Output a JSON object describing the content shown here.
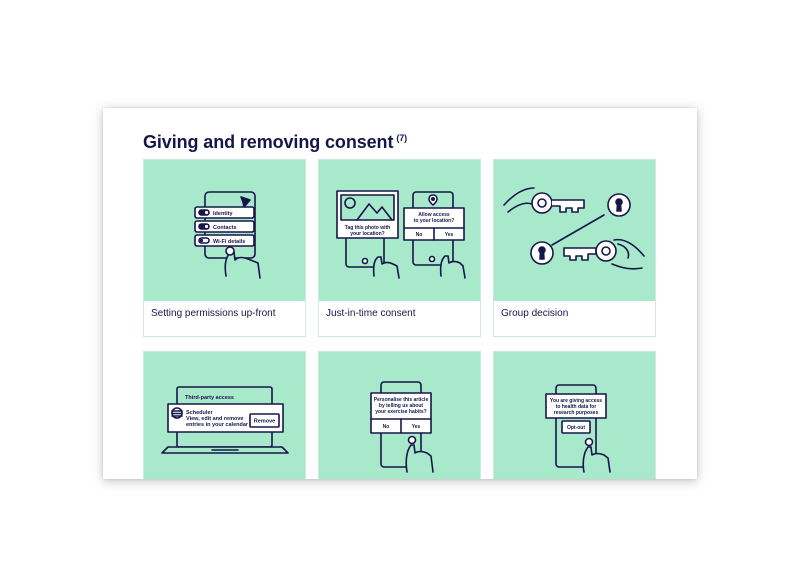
{
  "section": {
    "title": "Giving and removing consent",
    "count": "(7)"
  },
  "cards": [
    {
      "label": "Setting permissions up-front",
      "art": {
        "items": [
          "Identity",
          "Contacts",
          "Wi-Fi details"
        ]
      }
    },
    {
      "label": "Just-in-time consent",
      "art": {
        "photo_prompt": [
          "Tag this photo with",
          "your location?"
        ],
        "location_prompt": [
          "Allow access",
          "to your location?"
        ],
        "no": "No",
        "yes": "Yes"
      }
    },
    {
      "label": "Group decision",
      "art": {}
    },
    {
      "label": "",
      "art": {
        "header": "Third-party access",
        "app_name": "Scheduler",
        "app_desc": [
          "View, edit and remove",
          "entries in your calendar"
        ],
        "remove": "Remove"
      }
    },
    {
      "label": "",
      "art": {
        "prompt": [
          "Personalise this article",
          "by telling us about",
          "your exercise habits?"
        ],
        "no": "No",
        "yes": "Yes"
      }
    },
    {
      "label": "",
      "art": {
        "prompt": [
          "You are giving access",
          "to health data for",
          "research purposes"
        ],
        "optout": "Opt-out"
      }
    }
  ],
  "colors": {
    "card_art_bg": "#a8e8cb",
    "ink": "#16164a",
    "card_border": "#cfe9df"
  }
}
